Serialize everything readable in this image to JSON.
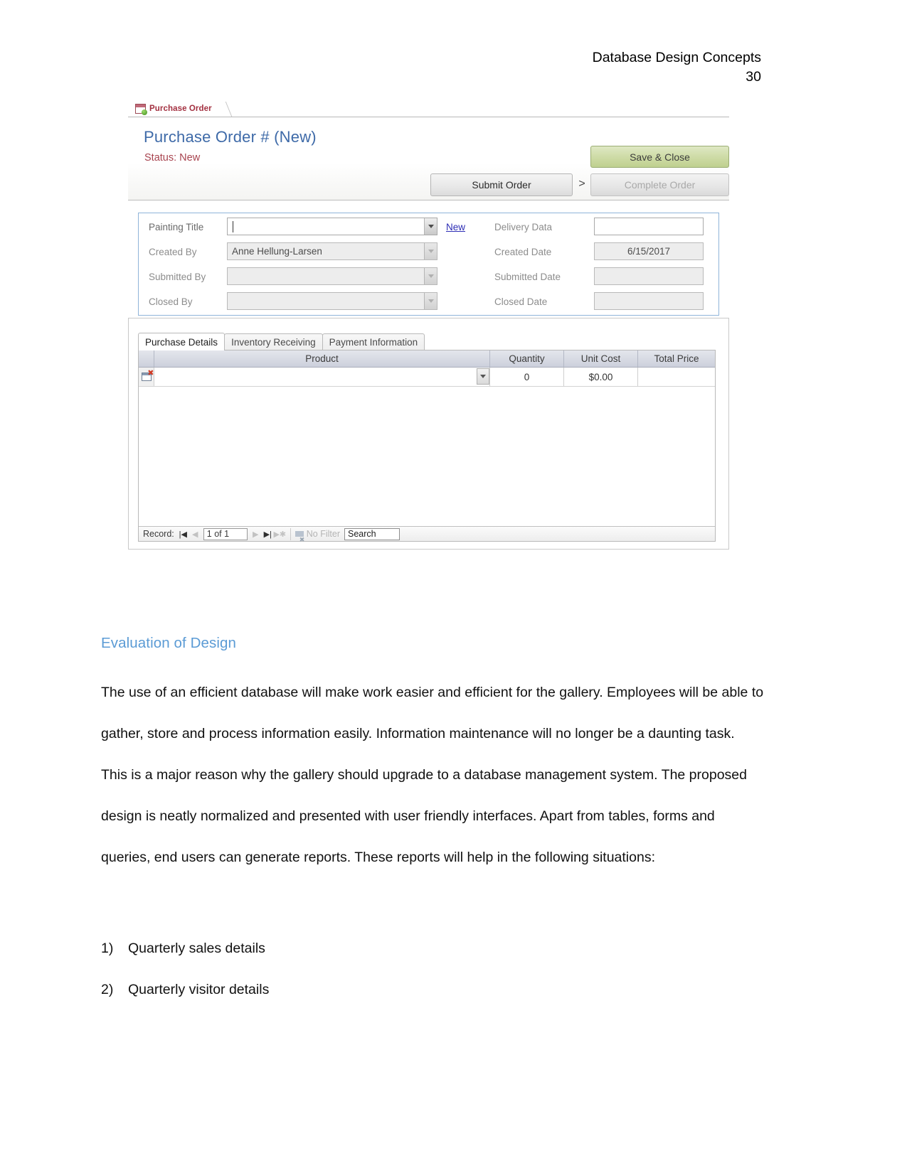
{
  "document": {
    "header_title": "Database Design Concepts",
    "page_number": "30",
    "section_heading": "Evaluation of Design",
    "paragraph": "The use of an efficient database will make work easier and efficient for the gallery. Employees will be able to gather, store and process information easily. Information maintenance will no longer be a daunting task. This is a major reason why the gallery should upgrade to a database management system. The proposed design is neatly normalized and presented with user friendly interfaces. Apart from tables, forms and queries, end users can generate reports. These reports will help in the following situations:",
    "list": [
      {
        "num": "1)",
        "text": "Quarterly sales details"
      },
      {
        "num": "2)",
        "text": "Quarterly visitor details"
      }
    ]
  },
  "access": {
    "object_tab": "Purchase Order",
    "form_title": "Purchase Order # (New)",
    "status": "Status: New",
    "buttons": {
      "save_close": "Save & Close",
      "submit_order": "Submit Order",
      "complete_order": "Complete Order",
      "arrow": ">"
    },
    "left_fields": [
      {
        "label": "Painting Title",
        "value": "",
        "disabled": false,
        "focused": true
      },
      {
        "label": "Created By",
        "value": "Anne Hellung-Larsen",
        "disabled": true,
        "focused": false
      },
      {
        "label": "Submitted By",
        "value": "",
        "disabled": true,
        "focused": false
      },
      {
        "label": "Closed By",
        "value": "",
        "disabled": true,
        "focused": false
      }
    ],
    "new_link": "New",
    "right_fields": [
      {
        "label": "Delivery Data",
        "value": "",
        "disabled": false
      },
      {
        "label": "Created Date",
        "value": "6/15/2017",
        "disabled": true
      },
      {
        "label": "Submitted Date",
        "value": "",
        "disabled": true
      },
      {
        "label": "Closed Date",
        "value": "",
        "disabled": true
      }
    ],
    "sub_tabs": [
      {
        "label": "Purchase Details",
        "active": true
      },
      {
        "label": "Inventory Receiving",
        "active": false
      },
      {
        "label": "Payment Information",
        "active": false
      }
    ],
    "datasheet": {
      "columns": [
        "Product",
        "Quantity",
        "Unit Cost",
        "Total Price"
      ],
      "rows": [
        {
          "product": "",
          "quantity": "0",
          "unit_cost": "$0.00",
          "total_price": ""
        }
      ]
    },
    "nav": {
      "record_label": "Record:",
      "first": "|◀",
      "prev": "◀",
      "position": "1 of 1",
      "next": "▶",
      "last": "▶|",
      "new": "▶✱",
      "filter_status": "No Filter",
      "search_placeholder": "Search",
      "search_value": "Search"
    },
    "colors": {
      "title_blue": "#3e6aa8",
      "status_red": "#a8444f",
      "tab_red": "#a33040",
      "save_green": "#bfd08f",
      "panel_border_blue": "#8fb4d9",
      "heading_blue": "#5b9bd5"
    }
  }
}
